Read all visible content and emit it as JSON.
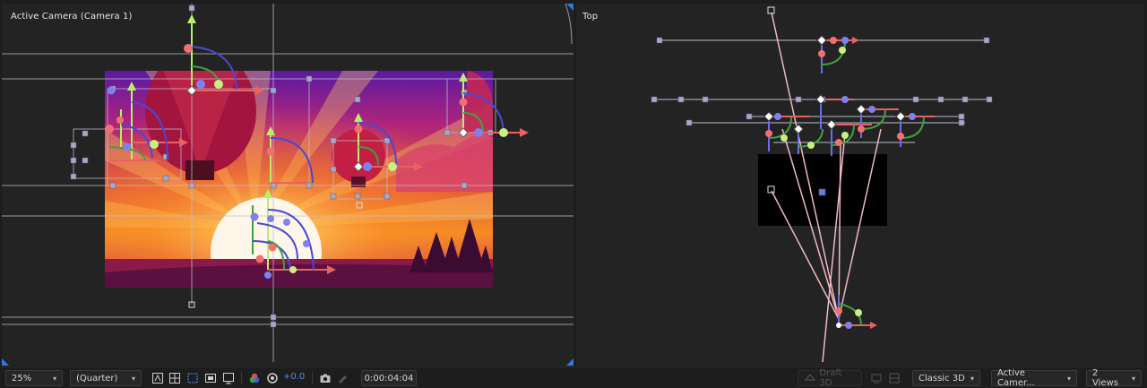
{
  "left_view": {
    "title": "Active Camera (Camera 1)"
  },
  "right_view": {
    "title": "Top"
  },
  "toolbar": {
    "magnification": "25%",
    "resolution": "(Quarter)",
    "exposure": "+0.0",
    "timecode": "0:00:04:04",
    "draft3d": "Draft 3D",
    "renderer": "Classic 3D",
    "camera_view": "Active Camer...",
    "views": "2 Views",
    "icons": [
      "toggle-mask-icon",
      "transparency-grid-icon",
      "region-of-interest-icon",
      "safe-margins-icon",
      "view-options-icon",
      "channel-rgb-icon",
      "reset-exposure-icon",
      "snapshot-icon",
      "show-snapshot-icon",
      "draft3d-icon",
      "extended-viewer-icon"
    ]
  },
  "colors": {
    "accent": "#2f7be0",
    "axis_x": "#e86262",
    "axis_y": "#b6f06a",
    "axis_z": "#6c6cf0",
    "handle": "#a7a7c9"
  }
}
